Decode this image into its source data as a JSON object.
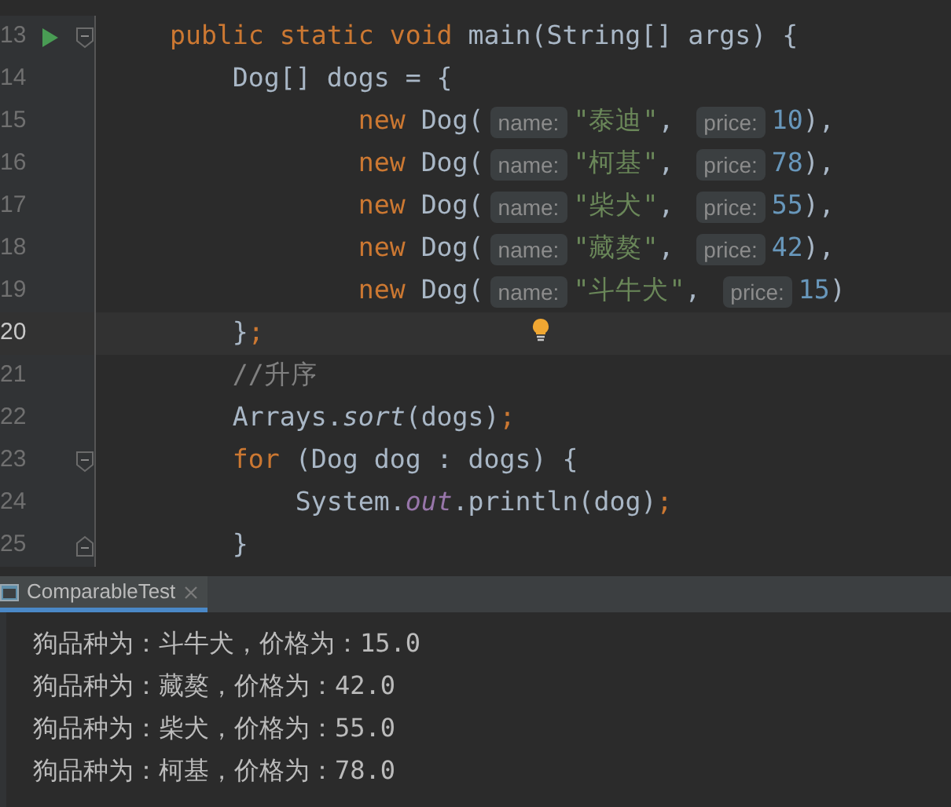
{
  "editor": {
    "lines": [
      {
        "number": "13",
        "run": true,
        "fold_start": true,
        "fold_end": false,
        "current": false,
        "bulb": false,
        "tokens": [
          {
            "kind": "kw",
            "text": "    public static void "
          },
          {
            "kind": "plain",
            "text": "main(String[] args) {"
          }
        ]
      },
      {
        "number": "14",
        "run": false,
        "fold_start": false,
        "fold_end": false,
        "current": false,
        "bulb": false,
        "tokens": [
          {
            "kind": "plain",
            "text": "        Dog[] dogs = {"
          }
        ]
      },
      {
        "number": "15",
        "run": false,
        "fold_start": false,
        "fold_end": false,
        "current": false,
        "bulb": false,
        "tokens": [
          {
            "kind": "kw",
            "text": "                new "
          },
          {
            "kind": "plain",
            "text": "Dog("
          },
          {
            "kind": "hint",
            "text": "name:"
          },
          {
            "kind": "str",
            "text": "\"泰迪\""
          },
          {
            "kind": "plain",
            "text": ", "
          },
          {
            "kind": "hint",
            "text": "price:"
          },
          {
            "kind": "num",
            "text": "10"
          },
          {
            "kind": "plain",
            "text": "),"
          }
        ]
      },
      {
        "number": "16",
        "run": false,
        "fold_start": false,
        "fold_end": false,
        "current": false,
        "bulb": false,
        "tokens": [
          {
            "kind": "kw",
            "text": "                new "
          },
          {
            "kind": "plain",
            "text": "Dog("
          },
          {
            "kind": "hint",
            "text": "name:"
          },
          {
            "kind": "str",
            "text": "\"柯基\""
          },
          {
            "kind": "plain",
            "text": ", "
          },
          {
            "kind": "hint",
            "text": "price:"
          },
          {
            "kind": "num",
            "text": "78"
          },
          {
            "kind": "plain",
            "text": "),"
          }
        ]
      },
      {
        "number": "17",
        "run": false,
        "fold_start": false,
        "fold_end": false,
        "current": false,
        "bulb": false,
        "tokens": [
          {
            "kind": "kw",
            "text": "                new "
          },
          {
            "kind": "plain",
            "text": "Dog("
          },
          {
            "kind": "hint",
            "text": "name:"
          },
          {
            "kind": "str",
            "text": "\"柴犬\""
          },
          {
            "kind": "plain",
            "text": ", "
          },
          {
            "kind": "hint",
            "text": "price:"
          },
          {
            "kind": "num",
            "text": "55"
          },
          {
            "kind": "plain",
            "text": "),"
          }
        ]
      },
      {
        "number": "18",
        "run": false,
        "fold_start": false,
        "fold_end": false,
        "current": false,
        "bulb": false,
        "tokens": [
          {
            "kind": "kw",
            "text": "                new "
          },
          {
            "kind": "plain",
            "text": "Dog("
          },
          {
            "kind": "hint",
            "text": "name:"
          },
          {
            "kind": "str",
            "text": "\"藏獒\""
          },
          {
            "kind": "plain",
            "text": ", "
          },
          {
            "kind": "hint",
            "text": "price:"
          },
          {
            "kind": "num",
            "text": "42"
          },
          {
            "kind": "plain",
            "text": "),"
          }
        ]
      },
      {
        "number": "19",
        "run": false,
        "fold_start": false,
        "fold_end": false,
        "current": false,
        "bulb": false,
        "tokens": [
          {
            "kind": "kw",
            "text": "                new "
          },
          {
            "kind": "plain",
            "text": "Dog("
          },
          {
            "kind": "hint",
            "text": "name:"
          },
          {
            "kind": "str",
            "text": "\"斗牛犬\""
          },
          {
            "kind": "plain",
            "text": ", "
          },
          {
            "kind": "hint",
            "text": "price:"
          },
          {
            "kind": "num",
            "text": "15"
          },
          {
            "kind": "plain",
            "text": ")"
          }
        ]
      },
      {
        "number": "20",
        "run": false,
        "fold_start": false,
        "fold_end": false,
        "current": true,
        "bulb": true,
        "tokens": [
          {
            "kind": "plain",
            "text": "        }"
          },
          {
            "kind": "kw",
            "text": ";"
          }
        ]
      },
      {
        "number": "21",
        "run": false,
        "fold_start": false,
        "fold_end": false,
        "current": false,
        "bulb": false,
        "tokens": [
          {
            "kind": "comment",
            "text": "        //升序"
          }
        ]
      },
      {
        "number": "22",
        "run": false,
        "fold_start": false,
        "fold_end": false,
        "current": false,
        "bulb": false,
        "tokens": [
          {
            "kind": "plain",
            "text": "        Arrays."
          },
          {
            "kind": "call",
            "text": "sort"
          },
          {
            "kind": "plain",
            "text": "(dogs)"
          },
          {
            "kind": "kw",
            "text": ";"
          }
        ]
      },
      {
        "number": "23",
        "run": false,
        "fold_start": true,
        "fold_end": false,
        "current": false,
        "bulb": false,
        "tokens": [
          {
            "kind": "kw",
            "text": "        for "
          },
          {
            "kind": "plain",
            "text": "(Dog dog : dogs) {"
          }
        ]
      },
      {
        "number": "24",
        "run": false,
        "fold_start": false,
        "fold_end": false,
        "current": false,
        "bulb": false,
        "tokens": [
          {
            "kind": "plain",
            "text": "            System."
          },
          {
            "kind": "field",
            "text": "out"
          },
          {
            "kind": "plain",
            "text": ".println(dog)"
          },
          {
            "kind": "kw",
            "text": ";"
          }
        ]
      },
      {
        "number": "25",
        "run": false,
        "fold_start": false,
        "fold_end": true,
        "current": false,
        "bulb": false,
        "tokens": [
          {
            "kind": "plain",
            "text": "        }"
          }
        ]
      }
    ]
  },
  "run_panel": {
    "tabs": [
      {
        "label": "ComparableTest",
        "selected": true
      }
    ],
    "output": [
      "狗品种为：斗牛犬，价格为：15.0",
      "狗品种为：藏獒，价格为：42.0",
      "狗品种为：柴犬，价格为：55.0",
      "狗品种为：柯基，价格为：78.0"
    ]
  }
}
